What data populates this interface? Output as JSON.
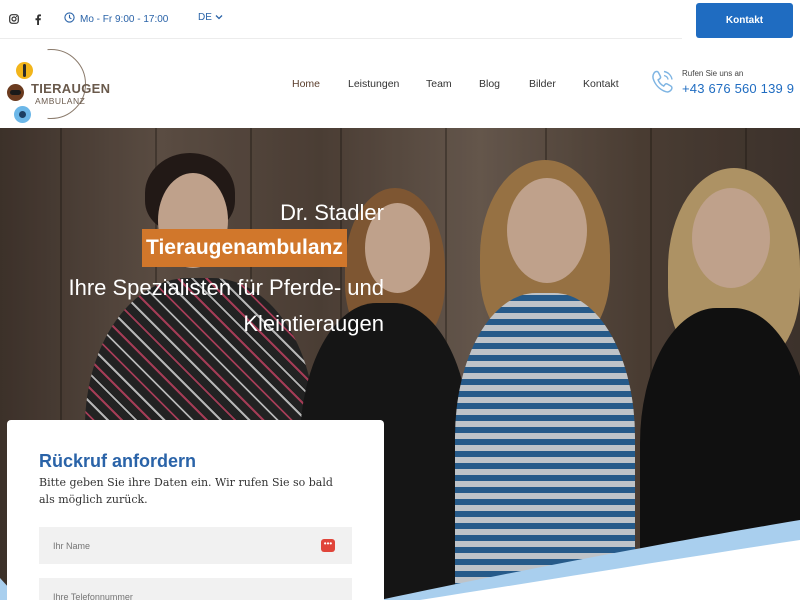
{
  "topbar": {
    "hours": "Mo - Fr 9:00 - 17:00",
    "language": "DE",
    "contact_button": "Kontakt",
    "social": [
      "instagram-icon",
      "facebook-icon"
    ]
  },
  "brand": {
    "title": "TIERAUGEN",
    "subtitle": "AMBULANZ"
  },
  "nav": {
    "items": [
      {
        "label": "Home",
        "active": true
      },
      {
        "label": "Leistungen"
      },
      {
        "label": "Team"
      },
      {
        "label": "Blog"
      },
      {
        "label": "Bilder"
      },
      {
        "label": "Kontakt"
      }
    ]
  },
  "call": {
    "label": "Rufen Sie uns an",
    "number": "+43 676 560 139 9"
  },
  "hero": {
    "line1": "Dr. Stadler",
    "highlight": "Tieraugenambulanz",
    "line3": "Ihre Spezialisten für Pferde- und Kleintieraugen"
  },
  "form": {
    "title": "Rückruf anfordern",
    "description": "Bitte geben Sie ihre Daten ein. Wir rufen Sie so bald als möglich zurück.",
    "name_placeholder": "Ihr Name",
    "phone_placeholder": "Ihre Telefonnummer",
    "badge": "•••"
  },
  "colors": {
    "primary_blue": "#1f6cc1",
    "accent_orange": "#d1772b",
    "wave_light_blue": "#a9cfee"
  }
}
